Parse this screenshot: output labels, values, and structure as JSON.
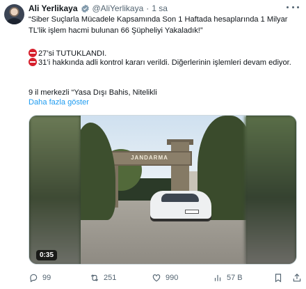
{
  "tweet": {
    "author_name": "Ali Yerlikaya",
    "handle": "@AliYerlikaya",
    "separator": "·",
    "time": "1 sa",
    "lines": {
      "l1": "“Siber Suçlarla Mücadele Kapsamında Son 1 Haftada hesaplarında 1 Milyar TL’lik işlem hacmi bulunan 66 Şüpheliyi Yakaladık!”",
      "l2": "27’si TUTUKLANDI.",
      "l3": "31’i hakkında adli kontrol kararı verildi. Diğerlerinin işlemleri devam ediyor.",
      "l4": "9 il merkezli “Yasa Dışı Bahis, Nitelikli"
    },
    "show_more": "Daha fazla göster"
  },
  "media": {
    "gate_text": "JANDARMA",
    "duration": "0:35"
  },
  "actions": {
    "replies": "99",
    "reposts": "251",
    "likes": "990",
    "views": "57 B"
  },
  "colors": {
    "accent": "#1d9bf0",
    "muted": "#536471",
    "text": "#0f1419"
  }
}
